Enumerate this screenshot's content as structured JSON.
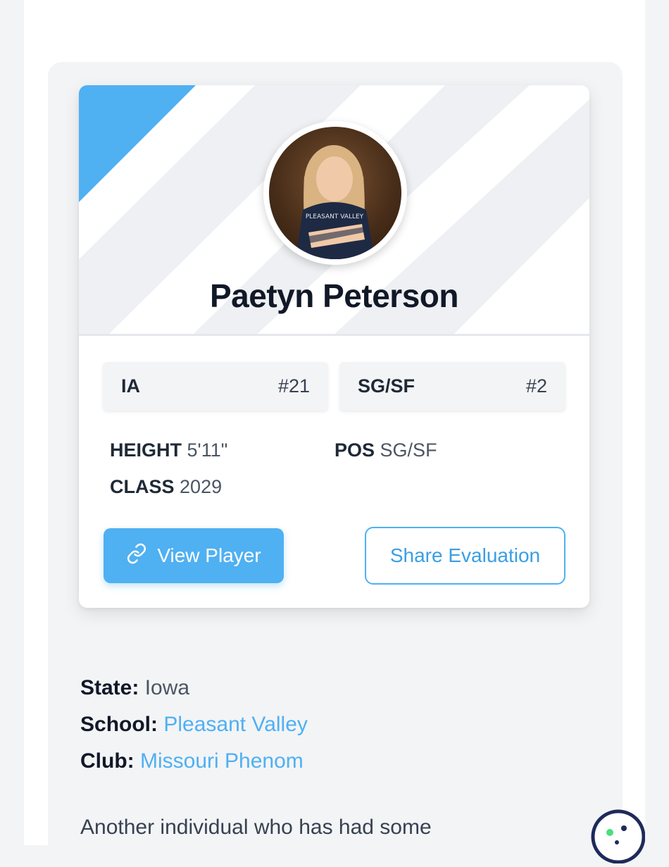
{
  "player": {
    "name": "Paetyn Peterson",
    "photo": "player-photo"
  },
  "badges": {
    "state": {
      "label": "IA",
      "rank": "#21"
    },
    "position": {
      "label": "SG/SF",
      "rank": "#2"
    }
  },
  "stats": {
    "height_label": "HEIGHT",
    "height_value": "5'11\"",
    "class_label": "CLASS",
    "class_value": "2029",
    "pos_label": "POS",
    "pos_value": "SG/SF"
  },
  "buttons": {
    "view_player": "View Player",
    "view_player_icon": "link-icon",
    "share_evaluation": "Share Evaluation"
  },
  "details": {
    "state_label": "State:",
    "state_value": "Iowa",
    "school_label": "School:",
    "school_value": "Pleasant Valley",
    "club_label": "Club:",
    "club_value": "Missouri Phenom"
  },
  "article": {
    "text": "Another individual who has had some"
  },
  "colors": {
    "accent": "#4fb0f2",
    "text": "#1f2937",
    "panel": "#f3f4f6"
  },
  "widgets": {
    "cookie_icon": "cookie-icon"
  }
}
